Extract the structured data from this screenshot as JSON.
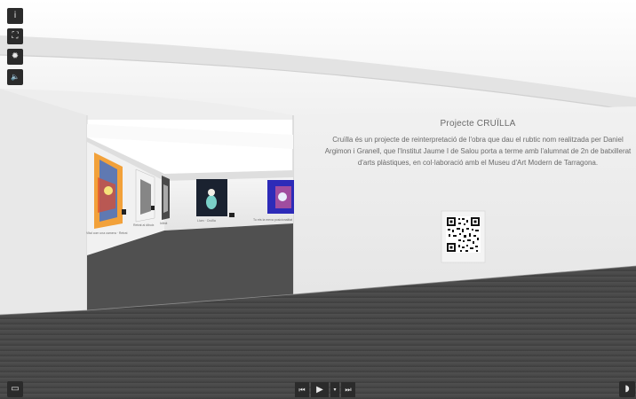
{
  "toolbar": {
    "info_icon": "i",
    "fullscreen_icon": "⛶",
    "settings_icon": "✹",
    "sound_icon": "🔈"
  },
  "exhibit": {
    "title": "Projecte CRUÏLLA",
    "description": "Cruïlla és un projecte de reinterpretació de l'obra que dau el rubtic nom realitzada per Daniel Argimon i Granell, que l'Institut Jaume I de Salou porta a terme amb l'alumnat de 2n de batxillerat d'arts plàstiques, en col·laboració amb el Museu d'Art Modern de Tarragona."
  },
  "artworks": [
    {
      "caption": "Vital com una camera · Retrat"
    },
    {
      "caption": "Retrat al dibuix"
    },
    {
      "caption": "Infinit"
    },
    {
      "caption": "Llum · Cruïlla"
    },
    {
      "caption": "Tu ets la meva posicionalitat"
    }
  ],
  "player": {
    "prev_icon": "⏮",
    "play_icon": "▶",
    "menu_icon": "▾",
    "next_icon": "⏭"
  },
  "corner": {
    "map_icon": "▭",
    "headset_icon": "◗"
  },
  "colors": {
    "panel_dark": "#2b2b2b",
    "wall": "#e9e9e9",
    "floor": "#4b4b4b",
    "text": "#6a6a6a"
  }
}
